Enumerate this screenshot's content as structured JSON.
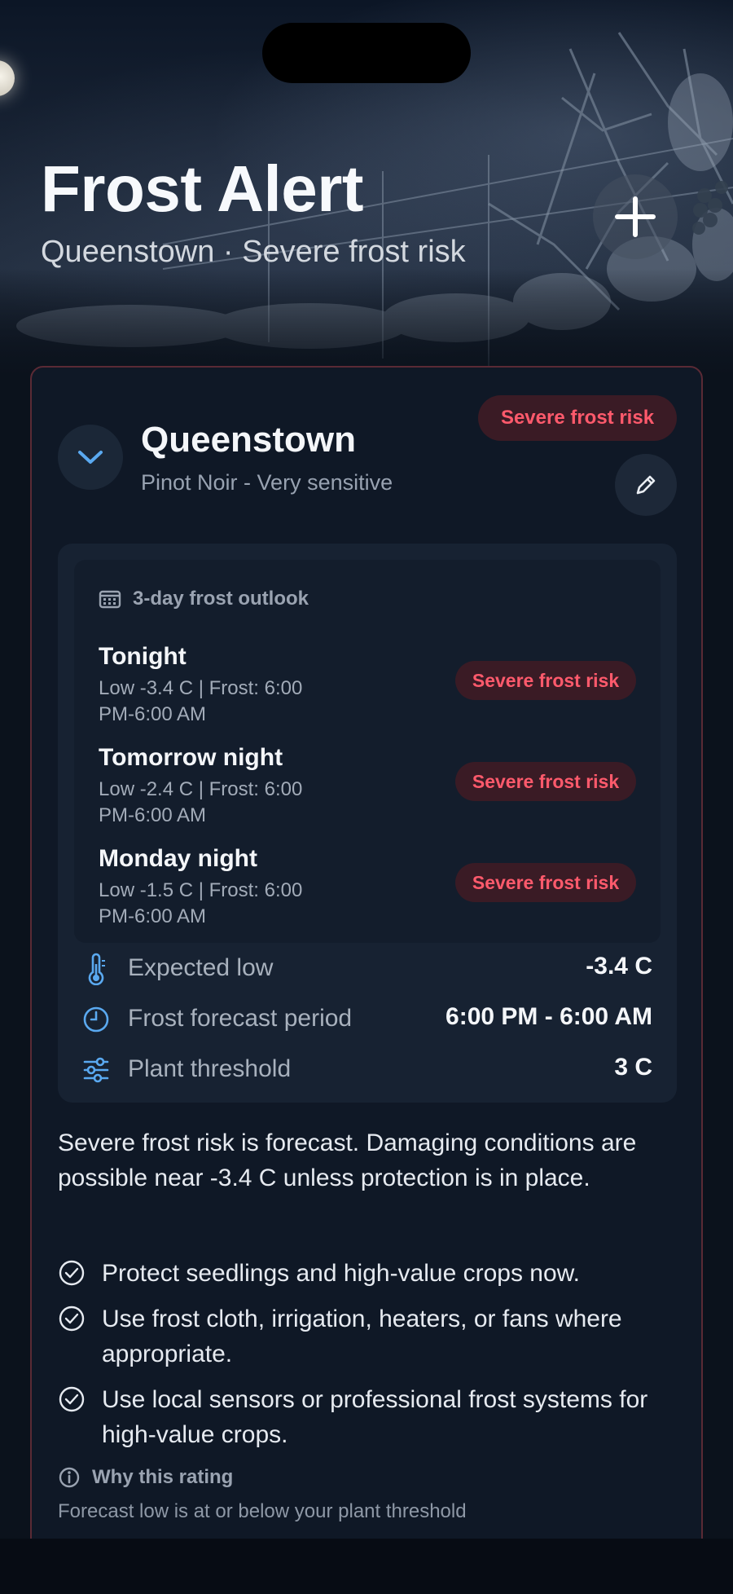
{
  "header": {
    "title": "Frost Alert",
    "subtitle": "Queenstown · Severe frost risk",
    "add_icon": "plus-icon"
  },
  "location": {
    "name": "Queenstown",
    "crop": "Pinot Noir - Very sensitive",
    "risk_badge": "Severe frost risk",
    "collapse_icon": "chevron-down-icon",
    "edit_icon": "pencil-icon"
  },
  "outlook": {
    "heading": "3-day frost outlook",
    "icon": "calendar-icon",
    "days": [
      {
        "name": "Tonight",
        "detail": "Low -3.4 C | Frost: 6:00 PM-6:00 AM",
        "risk": "Severe frost risk"
      },
      {
        "name": "Tomorrow night",
        "detail": "Low -2.4 C | Frost: 6:00 PM-6:00 AM",
        "risk": "Severe frost risk"
      },
      {
        "name": "Monday night",
        "detail": "Low -1.5 C | Frost: 6:00 PM-6:00 AM",
        "risk": "Severe frost risk"
      }
    ]
  },
  "stats": [
    {
      "icon": "thermometer-icon",
      "label": "Expected low",
      "value": "-3.4 C"
    },
    {
      "icon": "clock-icon",
      "label": "Frost forecast period",
      "value": "6:00 PM - 6:00 AM"
    },
    {
      "icon": "sliders-icon",
      "label": "Plant threshold",
      "value": "3 C"
    }
  ],
  "description": "Severe frost risk is forecast. Damaging conditions are possible near -3.4 C unless protection is in place.",
  "recommendations": [
    "Protect seedlings and high-value crops now.",
    "Use frost cloth, irrigation, heaters, or fans where appropriate.",
    "Use local sensors or professional frost systems for high-value crops."
  ],
  "why": {
    "heading": "Why this rating",
    "detail": "Forecast low is at or below your plant threshold"
  },
  "colors": {
    "risk_text": "#ff5a6c",
    "risk_bg": "#3a1b25",
    "accent_blue": "#5aa9f0",
    "card_border": "#5a2a35"
  }
}
